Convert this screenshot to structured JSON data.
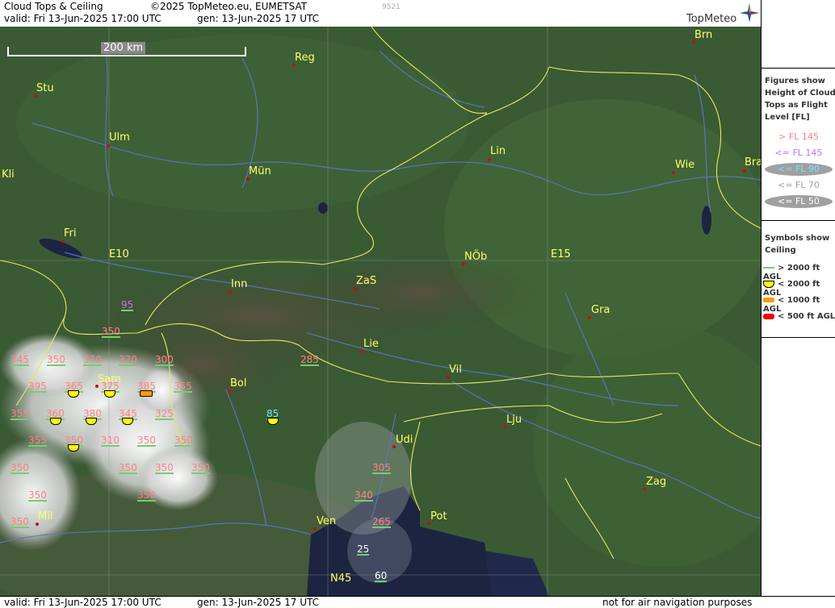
{
  "header": {
    "title": "Cloud Tops & Ceiling",
    "copyright": "©2025 TopMeteo.eu, EUMETSAT",
    "valid": "valid:  Fri  13-Jun-2025  17:00 UTC",
    "gen": "gen: 13-Jun-2025 17 UTC",
    "code": "9521",
    "logo": "TopMeteo"
  },
  "scale": {
    "label": "200 km"
  },
  "cities": [
    {
      "name": "Brn"
    },
    {
      "name": "Reg"
    },
    {
      "name": "Stu"
    },
    {
      "name": "Ulm"
    },
    {
      "name": "Kli"
    },
    {
      "name": "Mün"
    },
    {
      "name": "Lin"
    },
    {
      "name": "Wie"
    },
    {
      "name": "Bra"
    },
    {
      "name": "Fri"
    },
    {
      "name": "E10"
    },
    {
      "name": "NÖb"
    },
    {
      "name": "E15"
    },
    {
      "name": "Inn"
    },
    {
      "name": "ZaS"
    },
    {
      "name": "Gra"
    },
    {
      "name": "Lie"
    },
    {
      "name": "Sam"
    },
    {
      "name": "Bol"
    },
    {
      "name": "Vil"
    },
    {
      "name": "Lju"
    },
    {
      "name": "Udi"
    },
    {
      "name": "Zag"
    },
    {
      "name": "Mil"
    },
    {
      "name": "Ven"
    },
    {
      "name": "Pot"
    },
    {
      "name": "N45"
    }
  ],
  "cloud_tops": [
    {
      "value": "95",
      "class": "violet"
    },
    {
      "value": "350",
      "class": "pink"
    },
    {
      "value": "345",
      "class": "pink"
    },
    {
      "value": "350",
      "class": "pink"
    },
    {
      "value": "370",
      "class": "pink"
    },
    {
      "value": "370",
      "class": "pink"
    },
    {
      "value": "300",
      "class": "pink"
    },
    {
      "value": "285",
      "class": "pink"
    },
    {
      "value": "395",
      "class": "pink"
    },
    {
      "value": "365",
      "class": "pink"
    },
    {
      "value": "375",
      "class": "pink"
    },
    {
      "value": "385",
      "class": "pink"
    },
    {
      "value": "355",
      "class": "pink"
    },
    {
      "value": "355",
      "class": "pink"
    },
    {
      "value": "360",
      "class": "pink"
    },
    {
      "value": "380",
      "class": "pink"
    },
    {
      "value": "345",
      "class": "pink"
    },
    {
      "value": "325",
      "class": "pink"
    },
    {
      "value": "85",
      "class": "cyan"
    },
    {
      "value": "355",
      "class": "pink"
    },
    {
      "value": "350",
      "class": "pink"
    },
    {
      "value": "310",
      "class": "pink"
    },
    {
      "value": "350",
      "class": "pink"
    },
    {
      "value": "350",
      "class": "pink"
    },
    {
      "value": "350",
      "class": "pink"
    },
    {
      "value": "350",
      "class": "pink"
    },
    {
      "value": "350",
      "class": "pink"
    },
    {
      "value": "350",
      "class": "pink"
    },
    {
      "value": "305",
      "class": "pink"
    },
    {
      "value": "350",
      "class": "pink"
    },
    {
      "value": "350",
      "class": "pink"
    },
    {
      "value": "340",
      "class": "pink"
    },
    {
      "value": "350",
      "class": "pink"
    },
    {
      "value": "265",
      "class": "pink"
    },
    {
      "value": "25",
      "class": "white"
    },
    {
      "value": "60",
      "class": "white"
    }
  ],
  "legend": {
    "tops_title": [
      "Figures show",
      "Height of Cloud",
      "Tops as Flight",
      "Level  [FL]"
    ],
    "tops_items": [
      {
        "label": "> FL 145",
        "color": "#ff8080"
      },
      {
        "label": "<= FL 145",
        "color": "#c070ff"
      },
      {
        "label": "<= FL 90",
        "color": "#70e8ff"
      },
      {
        "label": "<= FL 70",
        "color": "#a0a0a0"
      },
      {
        "label": "<= FL 50",
        "color": "#ffffff"
      }
    ],
    "ceiling_title": [
      "Symbols show",
      "Ceiling"
    ],
    "ceiling_items": [
      {
        "label": "> 2000 ft AGL",
        "color": "#70d070"
      },
      {
        "label": "< 2000 ft AGL",
        "color": "#ffff00"
      },
      {
        "label": "< 1000 ft AGL",
        "color": "#ff9900"
      },
      {
        "label": "< 500 ft AGL",
        "color": "#ee0000"
      }
    ]
  },
  "footer": {
    "valid": "valid:  Fri  13-Jun-2025  17:00 UTC",
    "gen": "gen: 13-Jun-2025 17 UTC",
    "disclaimer": "not for air navigation purposes"
  }
}
